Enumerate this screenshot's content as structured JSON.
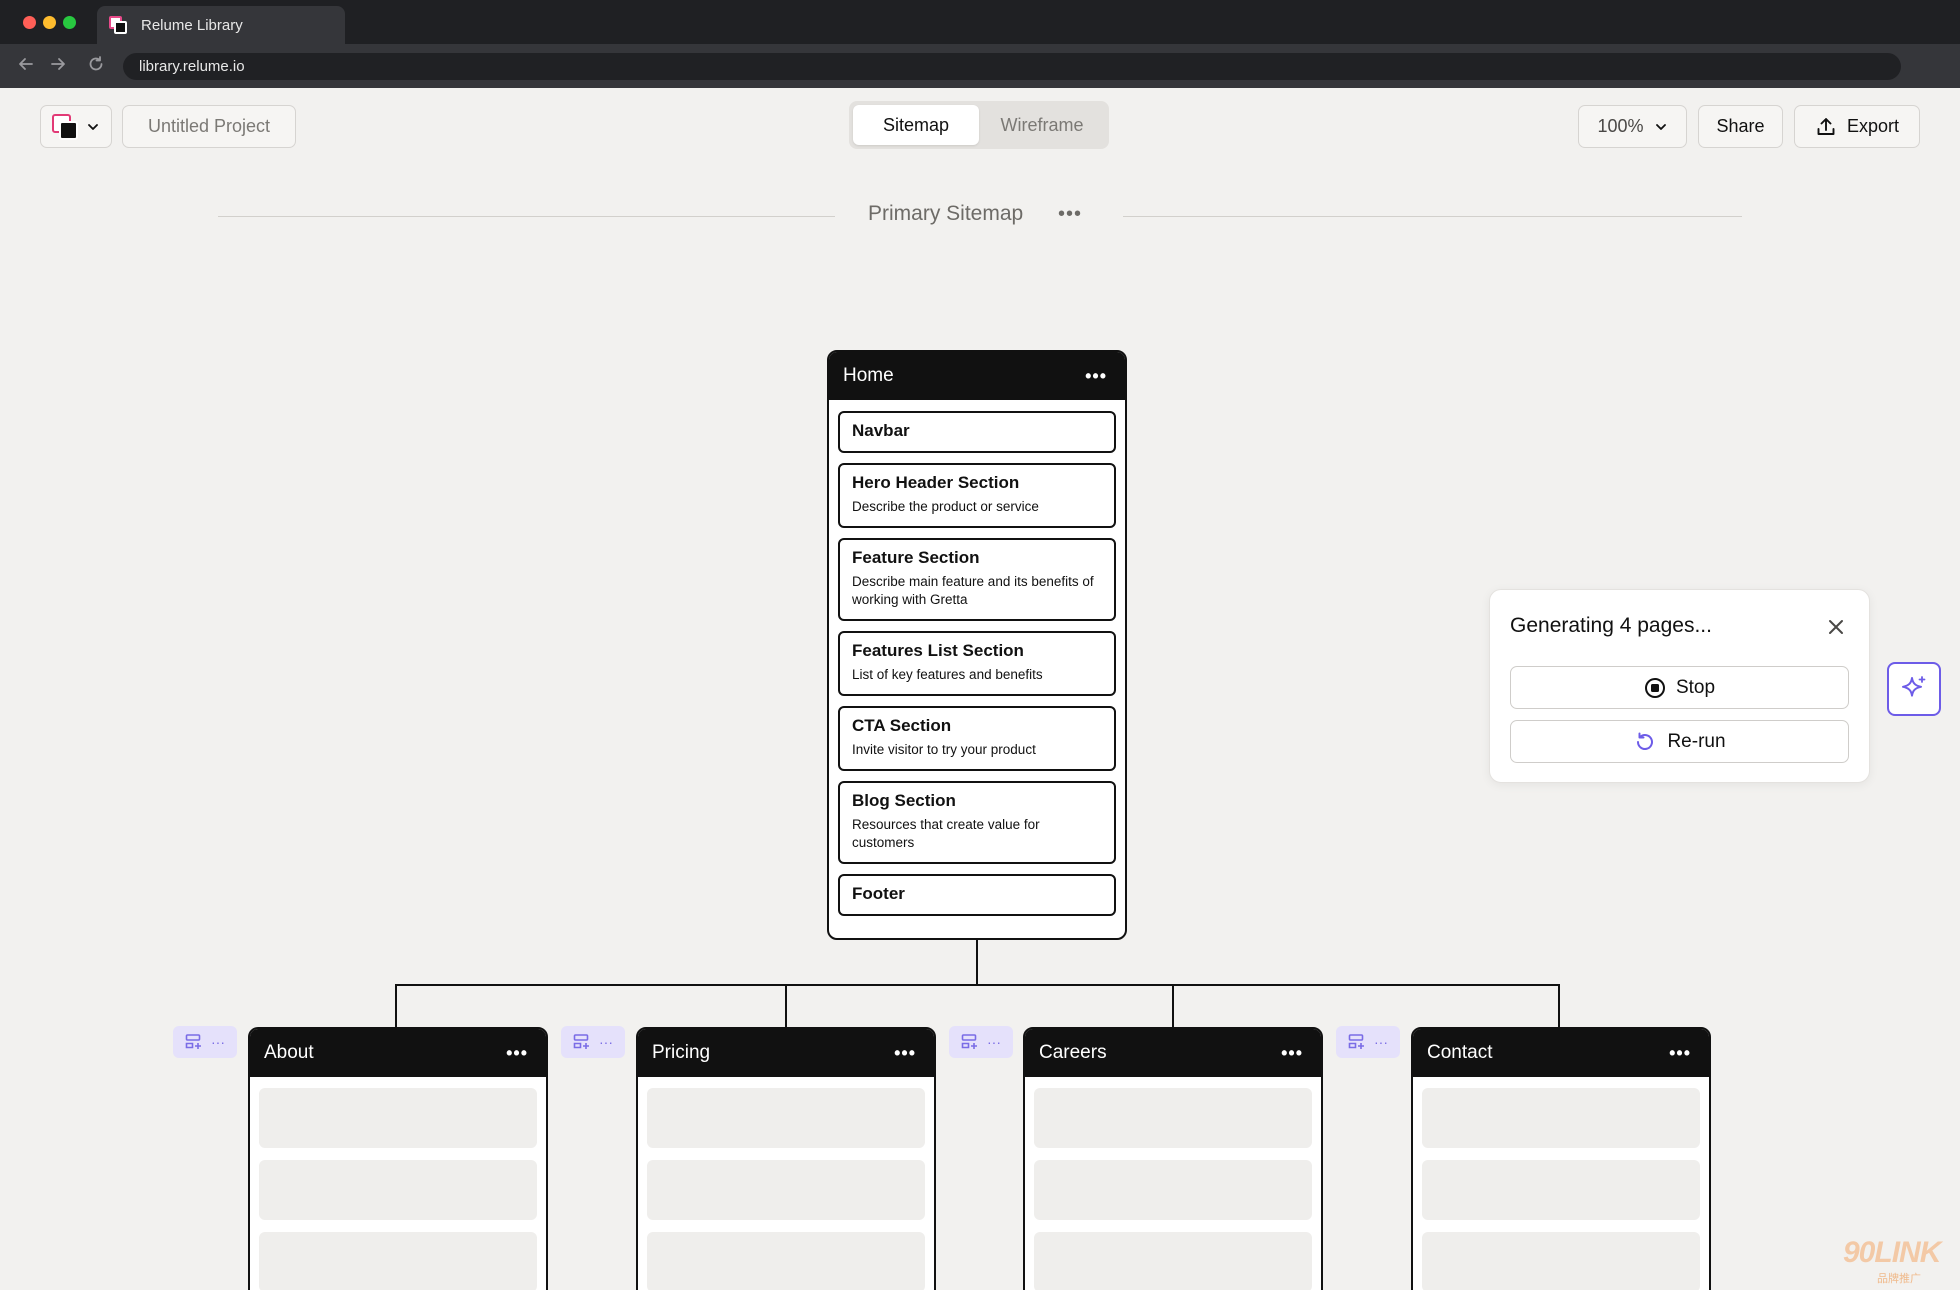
{
  "browser": {
    "tab_title": "Relume Library",
    "url": "library.relume.io"
  },
  "toolbar": {
    "project_name": "Untitled Project",
    "view_tabs": [
      {
        "label": "Sitemap",
        "active": true
      },
      {
        "label": "Wireframe",
        "active": false
      }
    ],
    "zoom_label": "100%",
    "share_label": "Share",
    "export_label": "Export"
  },
  "sitemap": {
    "title": "Primary Sitemap",
    "menu_label": "•••"
  },
  "home_page": {
    "title": "Home",
    "menu_label": "•••",
    "sections": [
      {
        "title": "Navbar",
        "description": ""
      },
      {
        "title": "Hero Header Section",
        "description": "Describe the product or service"
      },
      {
        "title": "Feature Section",
        "description": "Describe main feature and its benefits of working with Gretta"
      },
      {
        "title": "Features List Section",
        "description": "List of key features and benefits"
      },
      {
        "title": "CTA Section",
        "description": "Invite visitor to try your product"
      },
      {
        "title": "Blog Section",
        "description": "Resources that create value for customers"
      },
      {
        "title": "Footer",
        "description": ""
      }
    ]
  },
  "child_pages": [
    {
      "title": "About",
      "menu_label": "•••"
    },
    {
      "title": "Pricing",
      "menu_label": "•••"
    },
    {
      "title": "Careers",
      "menu_label": "•••"
    },
    {
      "title": "Contact",
      "menu_label": "•••"
    }
  ],
  "add_section_menu_label": "···",
  "generation_panel": {
    "title": "Generating 4 pages...",
    "stop_label": "Stop",
    "rerun_label": "Re-run"
  },
  "watermark": {
    "brand": "90LINK",
    "tagline": "品牌推广"
  },
  "colors": {
    "accent": "#6d5ce8",
    "canvas": "#f2f1ef",
    "card_header": "#111111"
  },
  "icons": [
    "back-arrow-icon",
    "forward-arrow-icon",
    "reload-icon",
    "chevron-down-icon",
    "upload-icon",
    "more-dots-icon",
    "close-icon",
    "stop-circle-icon",
    "rerun-icon",
    "sparkle-icon",
    "add-section-icon"
  ]
}
